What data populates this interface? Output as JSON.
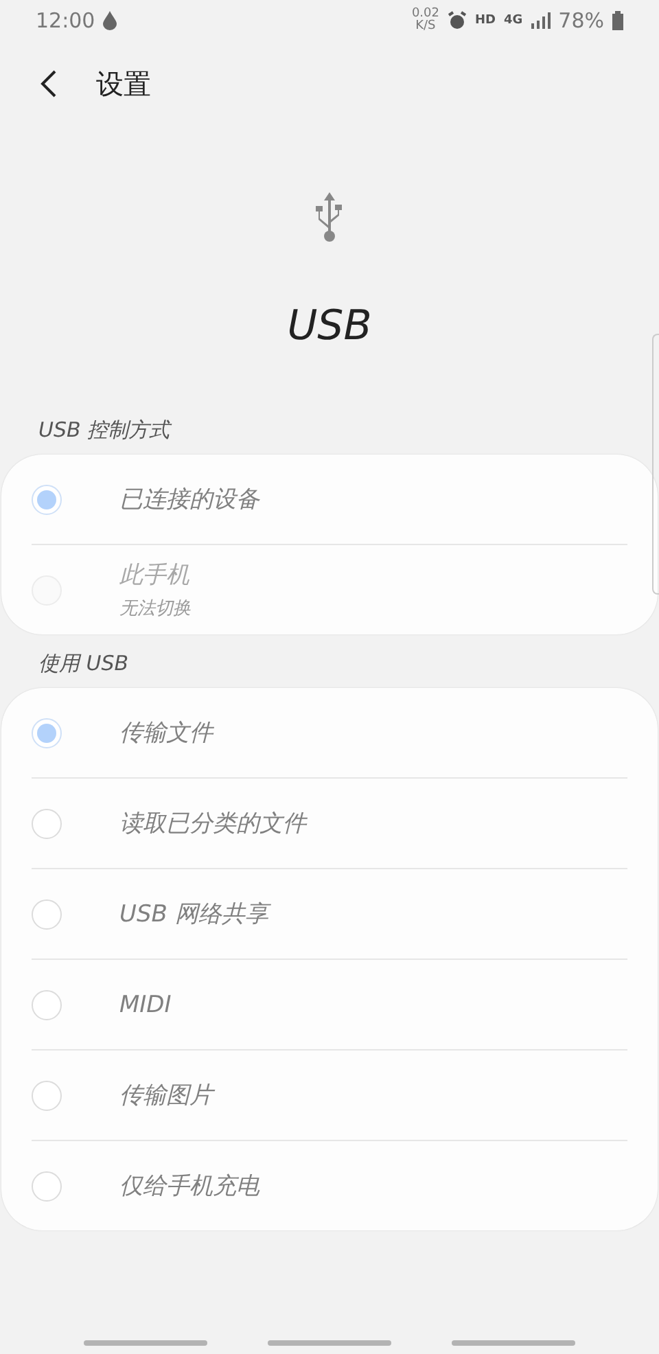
{
  "status_bar": {
    "time": "12:00",
    "speed_value": "0.02",
    "speed_unit": "K/S",
    "hd": "HD",
    "network": "4G",
    "battery": "78%"
  },
  "header": {
    "title": "设置"
  },
  "hero": {
    "title": "USB"
  },
  "sections": [
    {
      "title": "USB 控制方式",
      "options": [
        {
          "label": "已连接的设备",
          "selected": true,
          "disabled": false
        },
        {
          "label": "此手机",
          "subtitle": "无法切换",
          "selected": false,
          "disabled": true
        }
      ]
    },
    {
      "title": "使用 USB",
      "options": [
        {
          "label": "传输文件",
          "selected": true,
          "disabled": false
        },
        {
          "label": "读取已分类的文件",
          "selected": false,
          "disabled": false
        },
        {
          "label": "USB 网络共享",
          "selected": false,
          "disabled": false
        },
        {
          "label": "MIDI",
          "selected": false,
          "disabled": false
        },
        {
          "label": "传输图片",
          "selected": false,
          "disabled": false
        },
        {
          "label": "仅给手机充电",
          "selected": false,
          "disabled": false
        }
      ]
    }
  ]
}
